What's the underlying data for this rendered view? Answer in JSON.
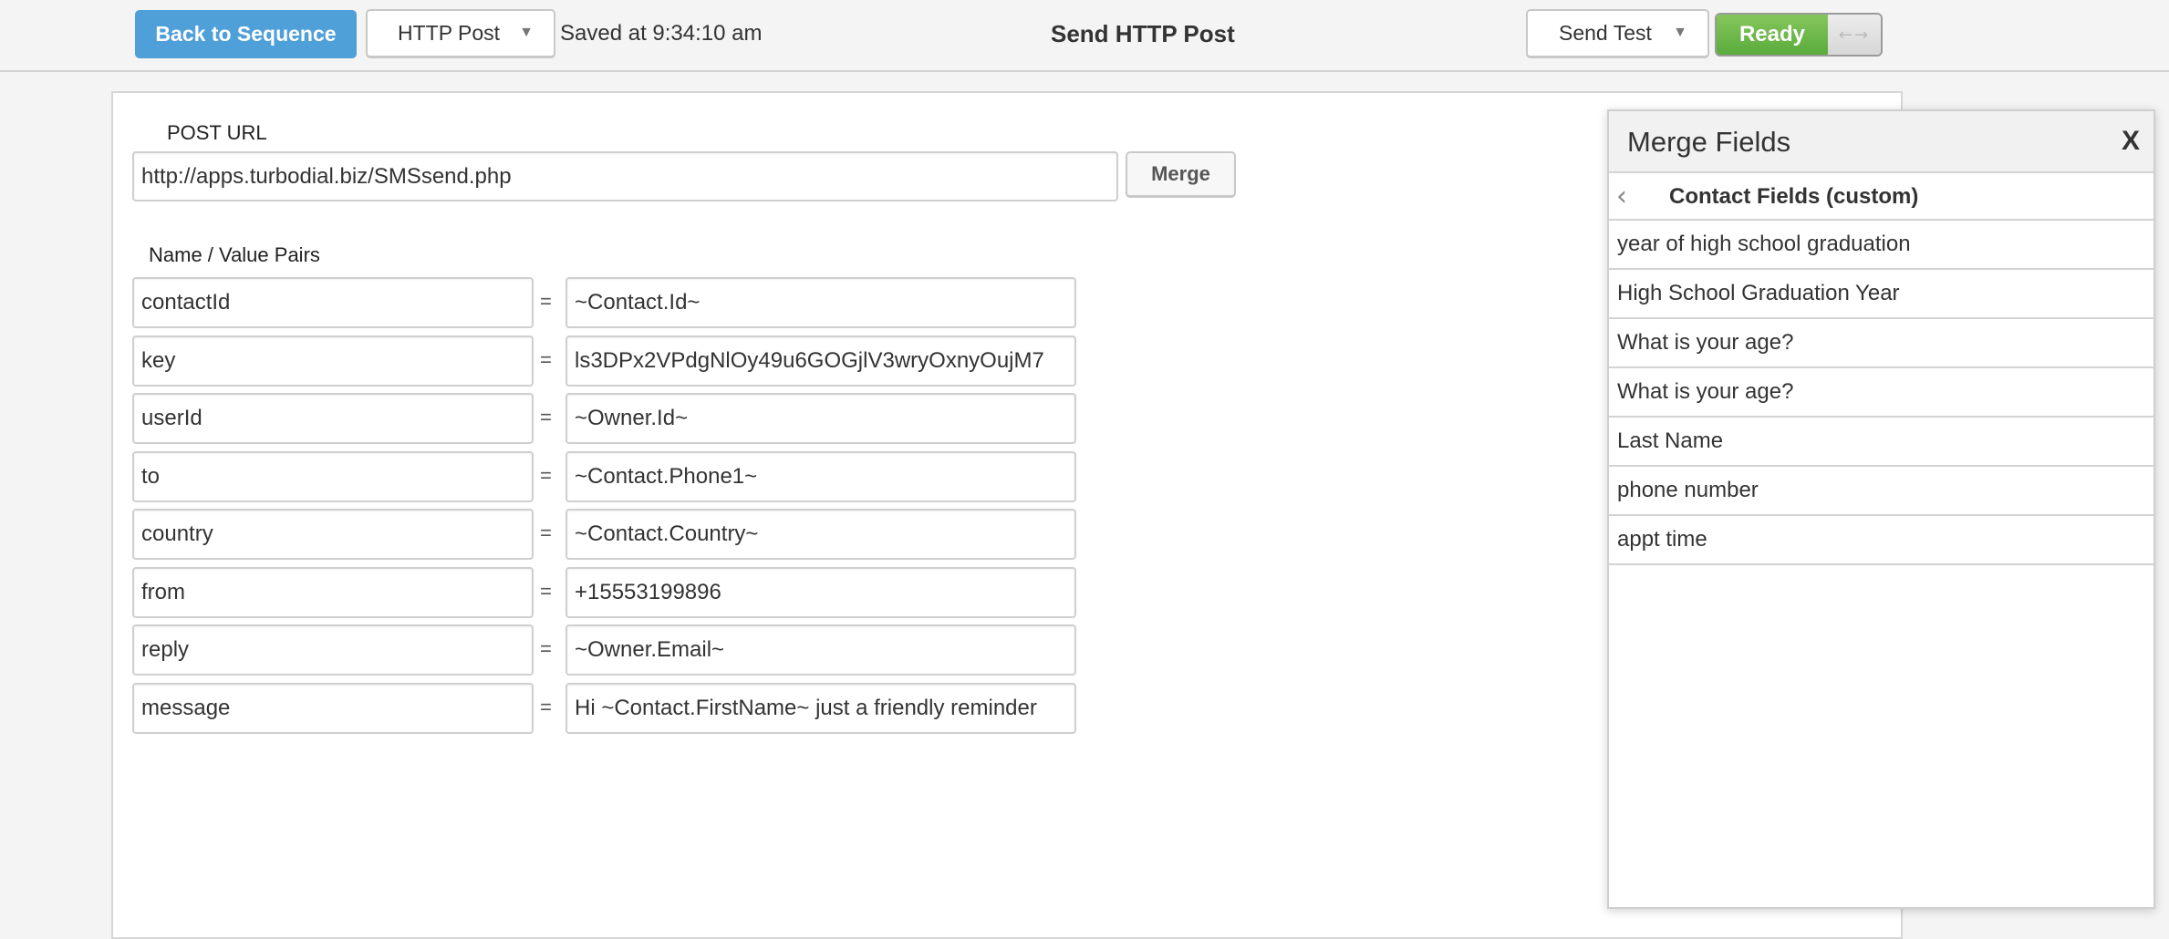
{
  "toolbar": {
    "back_label": "Back to Sequence",
    "type_dropdown": "HTTP Post",
    "saved_status": "Saved at 9:34:10 am",
    "title": "Send HTTP Post",
    "send_test_dropdown": "Send Test",
    "ready_label": "Ready",
    "arrows_glyph": "←→"
  },
  "form": {
    "post_url_label": "POST URL",
    "post_url_value": "http://apps.turbodial.biz/SMSsend.php",
    "merge_label": "Merge",
    "pairs_label": "Name / Value Pairs",
    "equals": "=",
    "pairs": [
      {
        "name": "contactId",
        "value": "~Contact.Id~"
      },
      {
        "name": "key",
        "value": "ls3DPx2VPdgNlOy49u6GOGjlV3wryOxnyOujM7"
      },
      {
        "name": "userId",
        "value": "~Owner.Id~"
      },
      {
        "name": "to",
        "value": "~Contact.Phone1~"
      },
      {
        "name": "country",
        "value": "~Contact.Country~"
      },
      {
        "name": "from",
        "value": "+15553199896"
      },
      {
        "name": "reply",
        "value": "~Owner.Email~"
      },
      {
        "name": "message",
        "value": "Hi ~Contact.FirstName~ just a friendly reminder"
      }
    ]
  },
  "merge_panel": {
    "title": "Merge Fields",
    "close_label": "X",
    "back_glyph": "‹",
    "section_title": "Contact Fields (custom)",
    "fields": [
      "year of high school graduation",
      "High School Graduation Year",
      "What is your age?",
      "What is your age?",
      "Last Name",
      "phone number",
      "appt time"
    ]
  }
}
